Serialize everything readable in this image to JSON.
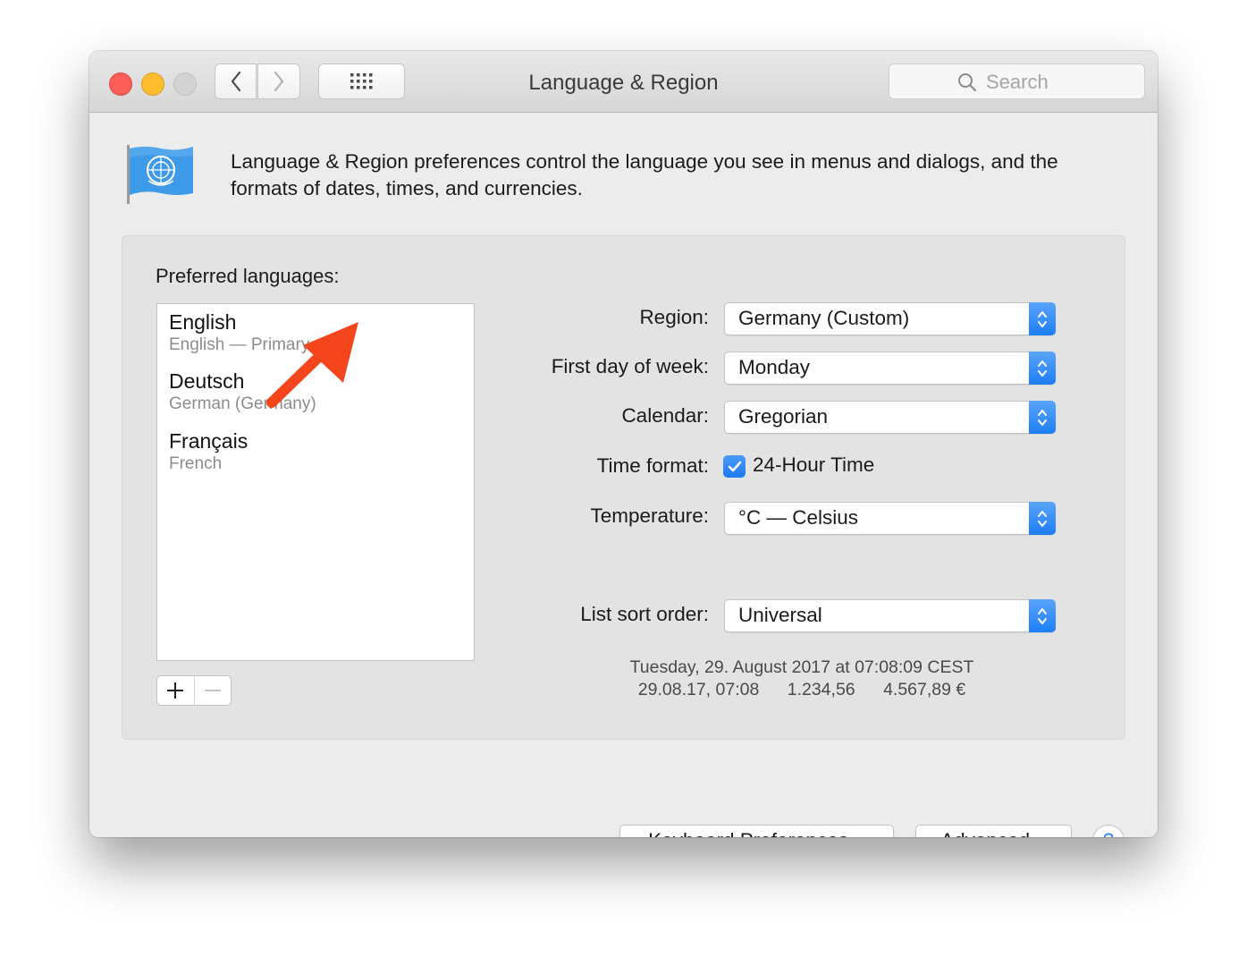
{
  "window": {
    "title": "Language & Region",
    "search_placeholder": "Search"
  },
  "toolbar": {
    "back_icon": "chevron-left-icon",
    "forward_icon": "chevron-right-icon",
    "show_all_icon": "grid-icon"
  },
  "intro": {
    "text": "Language & Region preferences control the language you see in menus and dialogs, and the formats of dates, times, and currencies."
  },
  "languages": {
    "label": "Preferred languages:",
    "items": [
      {
        "name": "English",
        "subtitle": "English — Primary"
      },
      {
        "name": "Deutsch",
        "subtitle": "German (Germany)"
      },
      {
        "name": "Français",
        "subtitle": "French"
      }
    ],
    "add_label": "+",
    "remove_label": "—"
  },
  "settings": {
    "region_label": "Region:",
    "region_value": "Germany (Custom)",
    "first_day_label": "First day of week:",
    "first_day_value": "Monday",
    "calendar_label": "Calendar:",
    "calendar_value": "Gregorian",
    "time_format_label": "Time format:",
    "time_format_checkbox_label": "24-Hour Time",
    "time_format_checked": true,
    "temperature_label": "Temperature:",
    "temperature_value": "°C — Celsius",
    "sort_order_label": "List sort order:",
    "sort_order_value": "Universal"
  },
  "sample": {
    "line1": "Tuesday, 29. August 2017 at 07:08:09 CEST",
    "date_short": "29.08.17, 07:08",
    "number": "1.234,56",
    "currency": "4.567,89 €"
  },
  "buttons": {
    "keyboard": "Keyboard Preferences...",
    "advanced": "Advanced...",
    "help": "?"
  },
  "colors": {
    "accent": "#1d7ef5",
    "annotation_arrow": "#f4451c"
  }
}
